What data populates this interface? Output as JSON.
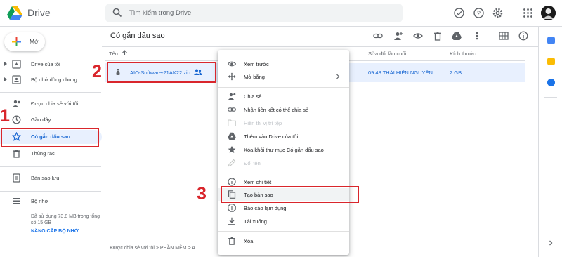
{
  "header": {
    "app_title": "Drive",
    "search_placeholder": "Tìm kiếm trong Drive"
  },
  "sidebar": {
    "new_label": "Mới",
    "items": [
      {
        "label": "Drive của tôi",
        "icon": "my-drive-icon"
      },
      {
        "label": "Bộ nhớ dùng chung",
        "icon": "shared-drives-icon"
      },
      {
        "label": "Được chia sẻ với tôi",
        "icon": "shared-with-me-icon"
      },
      {
        "label": "Gần đây",
        "icon": "recent-icon"
      },
      {
        "label": "Có gắn dấu sao",
        "icon": "star-icon"
      },
      {
        "label": "Thùng rác",
        "icon": "trash-icon"
      },
      {
        "label": "Bản sao lưu",
        "icon": "backup-icon"
      },
      {
        "label": "Bộ nhớ",
        "icon": "storage-icon"
      }
    ],
    "storage_text": "Đã sử dụng 73,8 MB trong tổng số 15 GB",
    "upgrade_label": "NÂNG CẤP BỘ NHỚ"
  },
  "main": {
    "title": "Có gắn dấu sao",
    "columns": {
      "name": "Tên",
      "modified": "Sửa đổi lần cuối",
      "size": "Kích thước"
    },
    "file": {
      "name": "AIO-Software-21AK22.zip",
      "modified": "09:48 THÁI HIỀN NGUYỄN",
      "size": "2 GB"
    },
    "breadcrumb": {
      "part1": "Được chia sẻ với tôi",
      "sep": ">",
      "part2": "PHẦN MỀM",
      "part3": "A"
    }
  },
  "context_menu": {
    "items": [
      {
        "label": "Xem trước",
        "icon": "eye-icon"
      },
      {
        "label": "Mở bằng",
        "icon": "open-with-icon"
      },
      {
        "label": "Chia sẻ",
        "icon": "share-icon"
      },
      {
        "label": "Nhận liên kết có thể chia sẻ",
        "icon": "link-icon"
      },
      {
        "label": "Hiển thị vị trí tệp",
        "icon": "folder-icon"
      },
      {
        "label": "Thêm vào Drive của tôi",
        "icon": "add-to-drive-icon"
      },
      {
        "label": "Xóa khỏi thư mục Có gắn dấu sao",
        "icon": "star-icon"
      },
      {
        "label": "Đổi tên",
        "icon": "pencil-icon"
      },
      {
        "label": "Xem chi tiết",
        "icon": "info-icon"
      },
      {
        "label": "Tạo bản sao",
        "icon": "copy-icon"
      },
      {
        "label": "Báo cáo lạm dụng",
        "icon": "report-icon"
      },
      {
        "label": "Tải xuống",
        "icon": "download-icon"
      },
      {
        "label": "Xóa",
        "icon": "trash-icon"
      }
    ]
  },
  "annotations": [
    "1",
    "2",
    "3"
  ],
  "colors": {
    "accent": "#1a73e8",
    "annotation": "#d9262c",
    "selected_bg": "#e8f0fe"
  }
}
